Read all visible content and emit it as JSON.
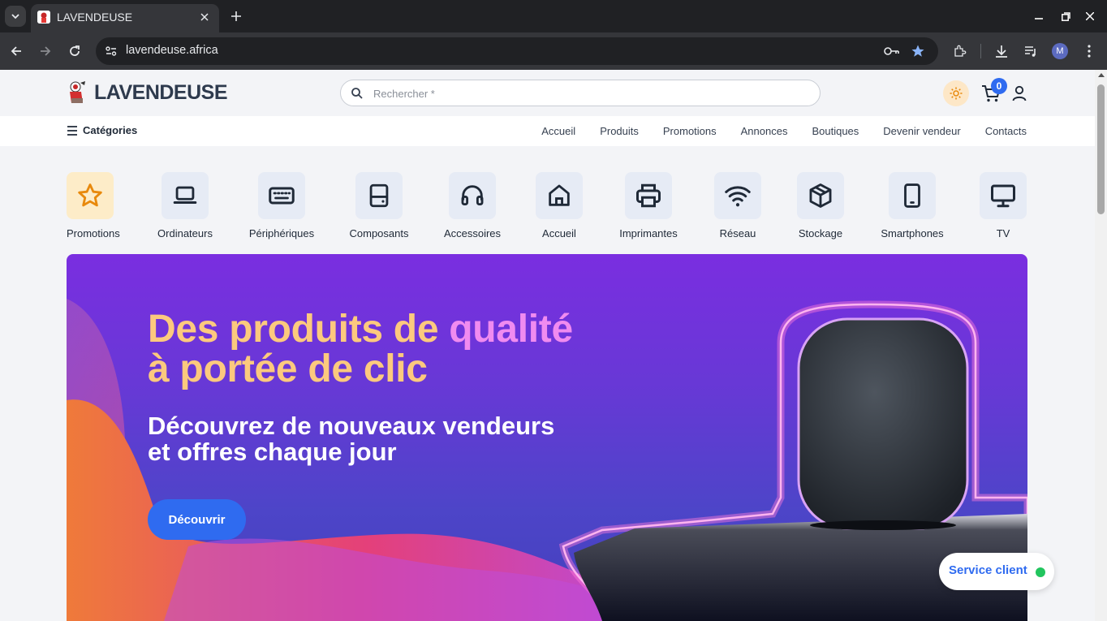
{
  "browser": {
    "tab_title": "LAVENDEUSE",
    "url": "lavendeuse.africa",
    "profile_initial": "M"
  },
  "site": {
    "logo_text": "LAVENDEUSE",
    "search_placeholder": "Rechercher *",
    "cart_count": "0"
  },
  "nav": {
    "categories_label": "Catégories",
    "links": [
      "Accueil",
      "Produits",
      "Promotions",
      "Annonces",
      "Boutiques",
      "Devenir vendeur",
      "Contacts"
    ]
  },
  "categories": [
    {
      "label": "Promotions",
      "icon": "star-icon"
    },
    {
      "label": "Ordinateurs",
      "icon": "laptop-icon"
    },
    {
      "label": "Périphériques",
      "icon": "keyboard-icon"
    },
    {
      "label": "Composants",
      "icon": "hard-drive-icon"
    },
    {
      "label": "Accessoires",
      "icon": "headphones-icon"
    },
    {
      "label": "Accueil",
      "icon": "home-icon"
    },
    {
      "label": "Imprimantes",
      "icon": "printer-icon"
    },
    {
      "label": "Réseau",
      "icon": "wifi-icon"
    },
    {
      "label": "Stockage",
      "icon": "box-icon"
    },
    {
      "label": "Smartphones",
      "icon": "smartphone-icon"
    },
    {
      "label": "TV",
      "icon": "monitor-icon"
    }
  ],
  "hero": {
    "title_part1": "Des produits de ",
    "title_highlight": "qualité",
    "title_line2": "à portée de clic",
    "subtitle_line1": "Découvrez de nouveaux vendeurs",
    "subtitle_line2": "et offres chaque jour",
    "button_label": "Découvrir"
  },
  "service": {
    "label": "Service client"
  },
  "colors": {
    "accent": "#2f6bf0",
    "hero_title": "#fcc97e",
    "hero_highlight": "#f08bf0",
    "online": "#22c55e"
  }
}
